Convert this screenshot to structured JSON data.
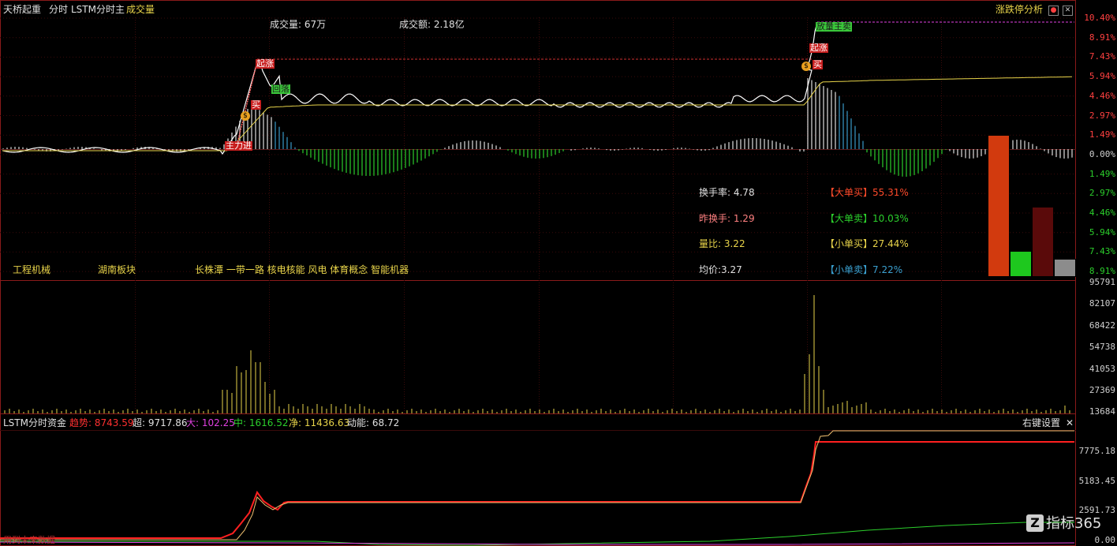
{
  "header": {
    "stock_name": "天桥起重",
    "mode": "分时",
    "indicator": "LSTM分时主",
    "volume_tab": "成交量",
    "limit_analysis": "涨跌停分析"
  },
  "info": {
    "volume": "成交量: 67万",
    "amount": "成交额: 2.18亿"
  },
  "price_axis": [
    "10.40%",
    "8.91%",
    "7.43%",
    "5.94%",
    "4.46%",
    "2.97%",
    "1.49%",
    "0.00%",
    "1.49%",
    "2.97%",
    "4.46%",
    "5.94%",
    "7.43%",
    "8.91%"
  ],
  "volume_axis": [
    "95791",
    "82107",
    "68422",
    "54738",
    "41053",
    "27369",
    "13684"
  ],
  "fund_axis": [
    "7775.18",
    "5183.45",
    "2591.73",
    "0.00"
  ],
  "tags": [
    "工程机械",
    "湖南板块",
    "长株潭 一带一路 核电核能 风电 体育概念 智能机器"
  ],
  "stats": {
    "turnover": "换手率: 4.78",
    "prev_turnover": "昨换手: 1.29",
    "volume_ratio": "量比: 3.22",
    "avg_price": "均价:3.27"
  },
  "orders": {
    "big_buy": "【大单买】55.31%",
    "big_sell": "【大单卖】10.03%",
    "small_buy": "【小单买】27.44%",
    "small_sell": "【小单卖】7.22%"
  },
  "order_bars": [
    {
      "name": "大单买",
      "value": 55.31,
      "color": "#d23a0e"
    },
    {
      "name": "大单卖",
      "value": 10.03,
      "color": "#1ec81e"
    },
    {
      "name": "小单买",
      "value": 27.44,
      "color": "#5a0a0a"
    },
    {
      "name": "小单卖",
      "value": 7.22,
      "color": "#8c8c8c"
    }
  ],
  "markers": {
    "main_buy_early": "主力进",
    "break1": "起涨",
    "buy1": "买",
    "pullback": "回落",
    "break2": "起涨",
    "buy2": "买",
    "volume_main_sell": "放量主卖"
  },
  "fund_panel": {
    "title": "LSTM分时资金",
    "trend": "趋势: 8743.59",
    "super": "超: 9717.86",
    "big": "大: 102.25",
    "mid": "中: 1616.52",
    "net": "净: 11436.63",
    "momentum": "动能: 68.72",
    "settings": "右键设置"
  },
  "footer": {
    "watermark_text": "用到未来数据",
    "brand": "指标365"
  },
  "colors": {
    "red": "#ff3030",
    "green": "#2ccf2c",
    "yellow": "#e8d44a",
    "magenta": "#e040e0",
    "cyan": "#3aa0d0"
  }
}
